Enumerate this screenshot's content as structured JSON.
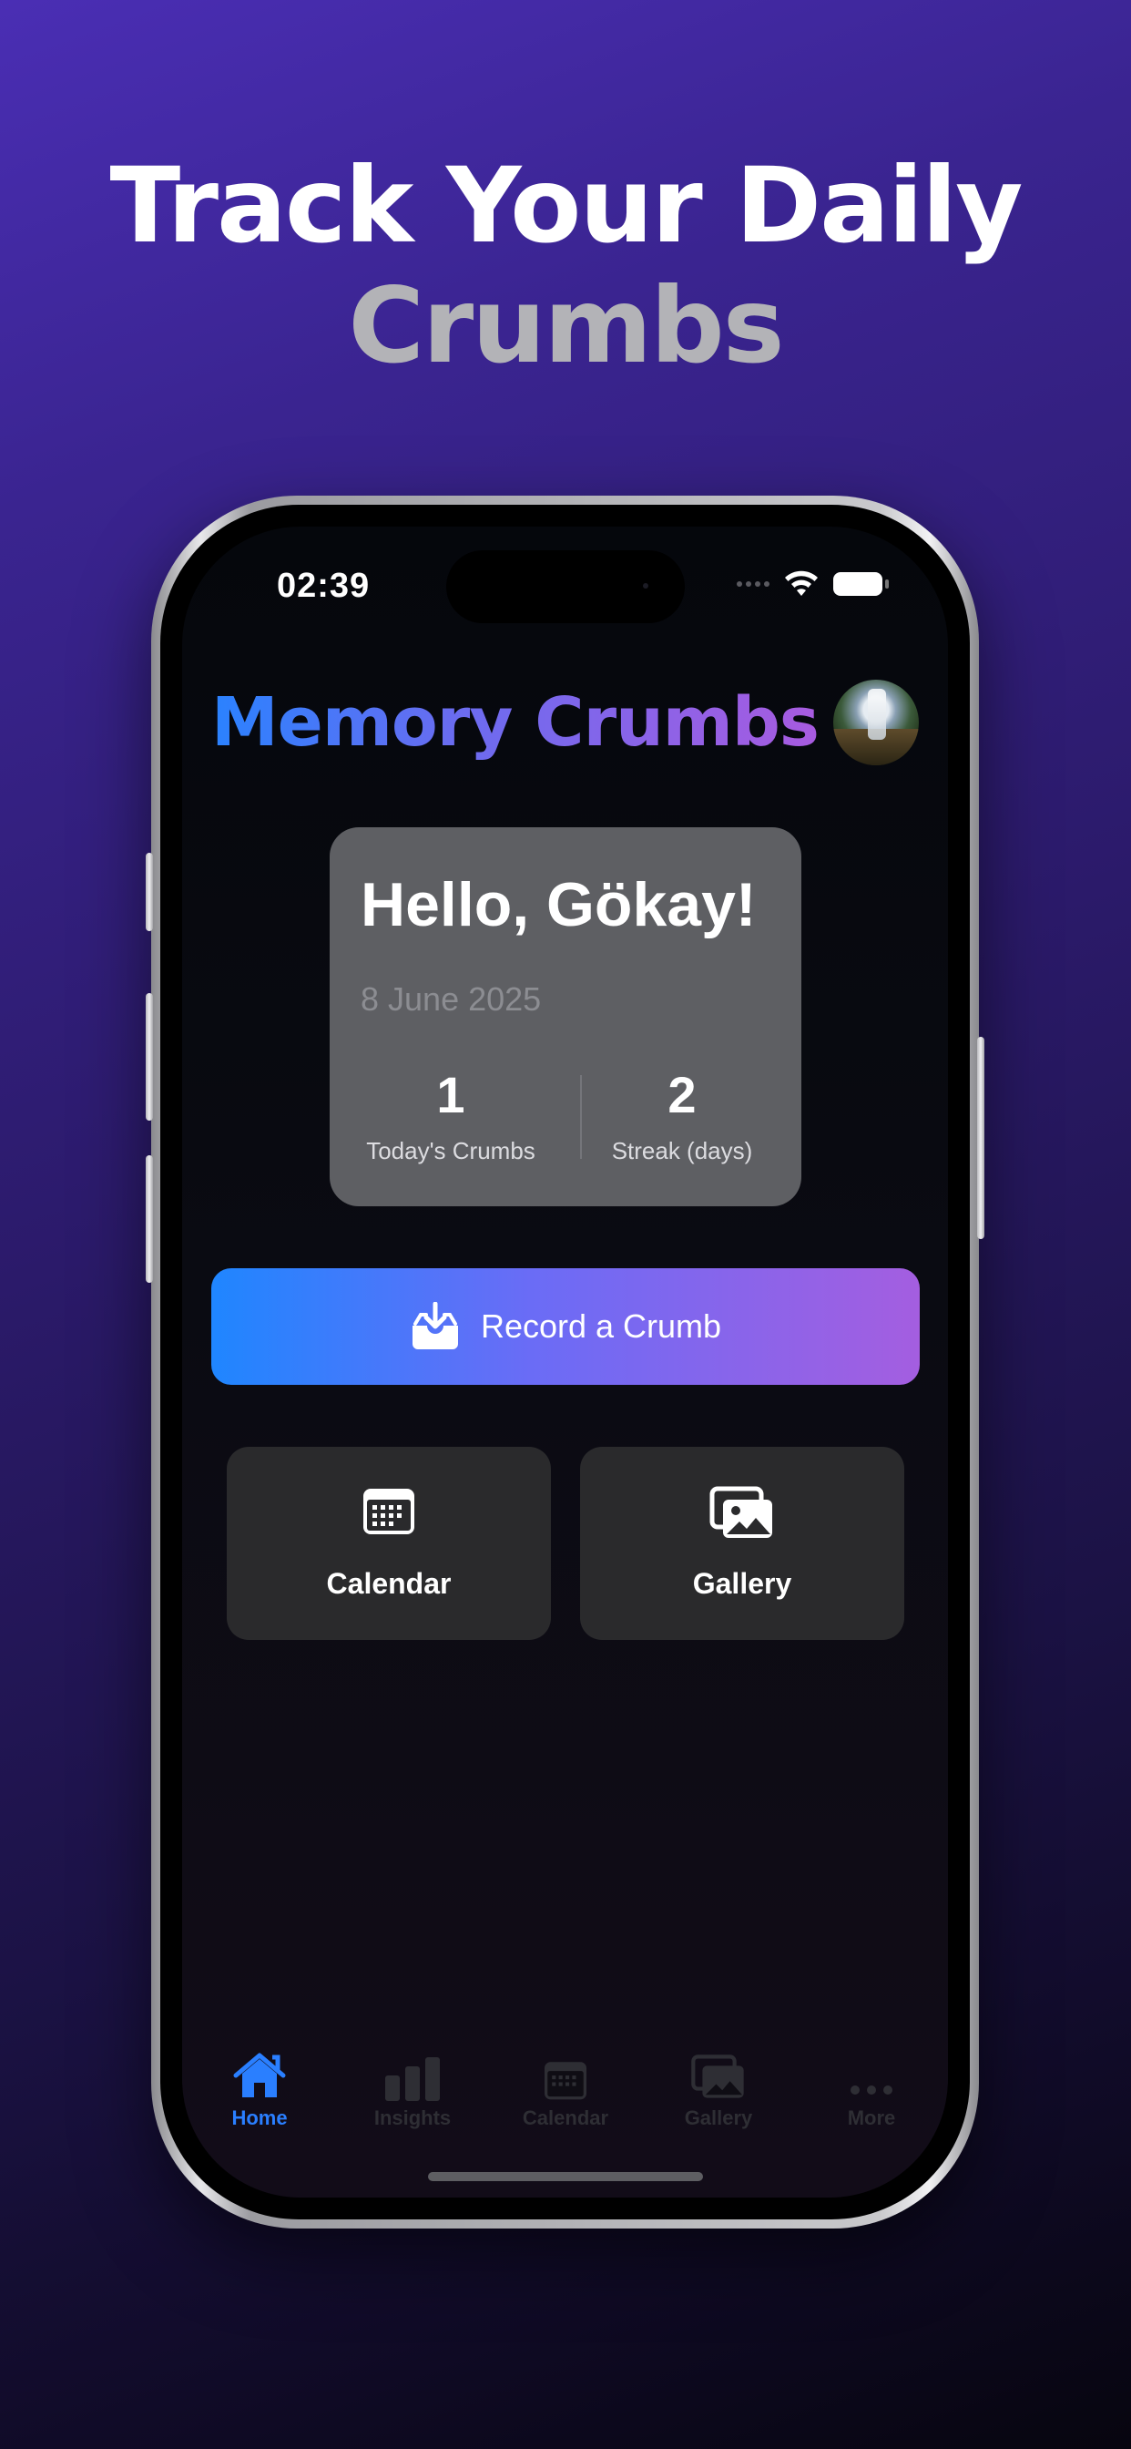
{
  "headline": {
    "line1": "Track Your Daily",
    "line2": "Crumbs"
  },
  "status_bar": {
    "time": "02:39"
  },
  "app": {
    "title": "Memory Crumbs"
  },
  "greeting_card": {
    "title": "Hello, Gökay!",
    "date": "8 June 2025",
    "stats": [
      {
        "value": "1",
        "label": "Today's Crumbs"
      },
      {
        "value": "2",
        "label": "Streak (days)"
      }
    ]
  },
  "record_button": {
    "label": "Record a Crumb",
    "icon": "tray-download-icon"
  },
  "tiles": [
    {
      "label": "Calendar",
      "icon": "calendar-icon"
    },
    {
      "label": "Gallery",
      "icon": "photo-stack-icon"
    }
  ],
  "tab_bar": {
    "items": [
      {
        "label": "Home",
        "icon": "house-icon",
        "active": true
      },
      {
        "label": "Insights",
        "icon": "bar-chart-icon",
        "active": false
      },
      {
        "label": "Calendar",
        "icon": "calendar-icon",
        "active": false
      },
      {
        "label": "Gallery",
        "icon": "photo-stack-icon",
        "active": false
      },
      {
        "label": "More",
        "icon": "ellipsis-icon",
        "active": false
      }
    ],
    "active_color": "#2a7fff",
    "inactive_color": "#2e2e34"
  },
  "colors": {
    "title_gradient": [
      "#2a82ff",
      "#a85be0"
    ],
    "button_gradient": [
      "#1f86ff",
      "#a45ee0"
    ],
    "card_bg": "#5e5f63",
    "tile_bg": "#2a2a2c"
  }
}
